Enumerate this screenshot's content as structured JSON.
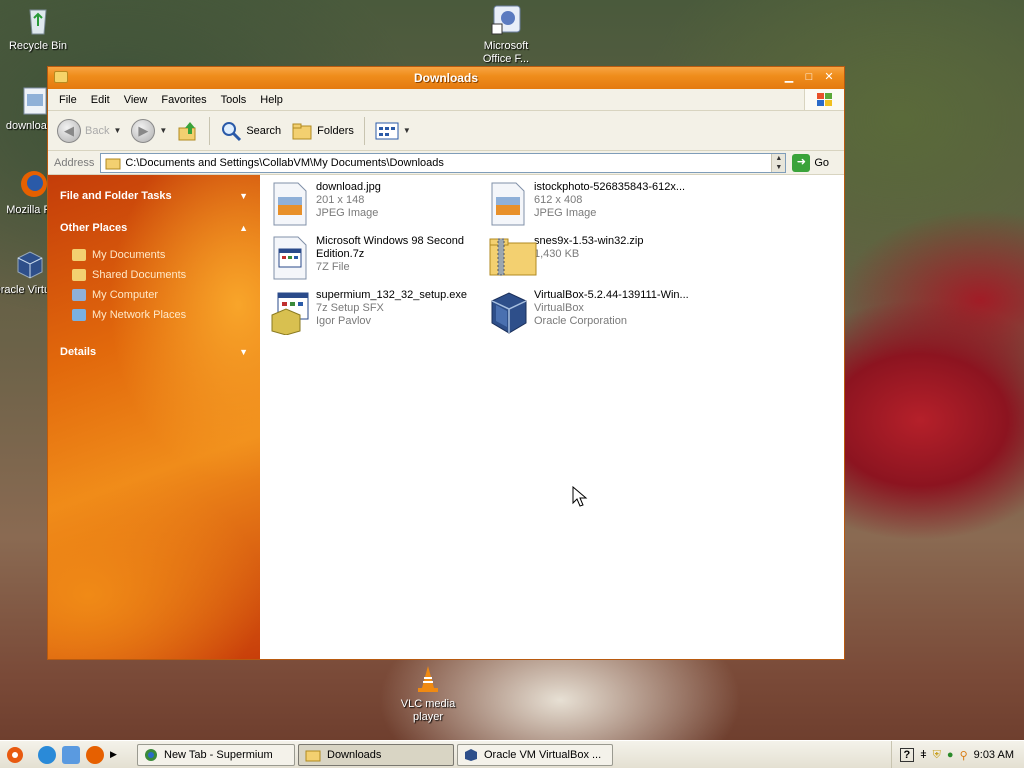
{
  "desktop": {
    "icons": [
      {
        "label": "Recycle Bin"
      },
      {
        "label": "download..."
      },
      {
        "label": "Mozilla Fi..."
      },
      {
        "label": "Oracle Virtual..."
      },
      {
        "label": "Microsoft Office F..."
      },
      {
        "label": "VLC media player"
      }
    ]
  },
  "window": {
    "title": "Downloads",
    "menu": [
      "File",
      "Edit",
      "View",
      "Favorites",
      "Tools",
      "Help"
    ],
    "toolbar": {
      "back": "Back",
      "search": "Search",
      "folders": "Folders"
    },
    "address": {
      "label": "Address",
      "value": "C:\\Documents and Settings\\CollabVM\\My Documents\\Downloads",
      "go": "Go"
    },
    "taskpane": {
      "file_folder_tasks": "File and Folder Tasks",
      "other_places": "Other Places",
      "places": [
        "My Documents",
        "Shared Documents",
        "My Computer",
        "My Network Places"
      ],
      "details": "Details"
    },
    "files": [
      {
        "name": "download.jpg",
        "line2": "201 x 148",
        "line3": "JPEG Image",
        "icon": "jpeg-image-icon"
      },
      {
        "name": "istockphoto-526835843-612x...",
        "line2": "612 x 408",
        "line3": "JPEG Image",
        "icon": "jpeg-image-icon"
      },
      {
        "name": "Microsoft Windows 98 Second",
        "name2": "Edition.7z",
        "line2": "7Z File",
        "icon": "7z-file-icon"
      },
      {
        "name": "snes9x-1.53-win32.zip",
        "line2": "1,430 KB",
        "icon": "zip-folder-icon"
      },
      {
        "name": "supermium_132_32_setup.exe",
        "line2": "7z Setup SFX",
        "line3": "Igor Pavlov",
        "icon": "setup-exe-icon"
      },
      {
        "name": "VirtualBox-5.2.44-139111-Win...",
        "line2": "VirtualBox",
        "line3": "Oracle Corporation",
        "icon": "virtualbox-icon"
      }
    ]
  },
  "taskbar": {
    "tasks": [
      {
        "label": "New Tab - Supermium"
      },
      {
        "label": "Downloads"
      },
      {
        "label": "Oracle VM VirtualBox ..."
      }
    ],
    "clock": "9:03 AM"
  },
  "colors": {
    "titlebar": "#ef8d1c",
    "taskpane": "#e2690c",
    "window_bg": "#ece9d8"
  }
}
